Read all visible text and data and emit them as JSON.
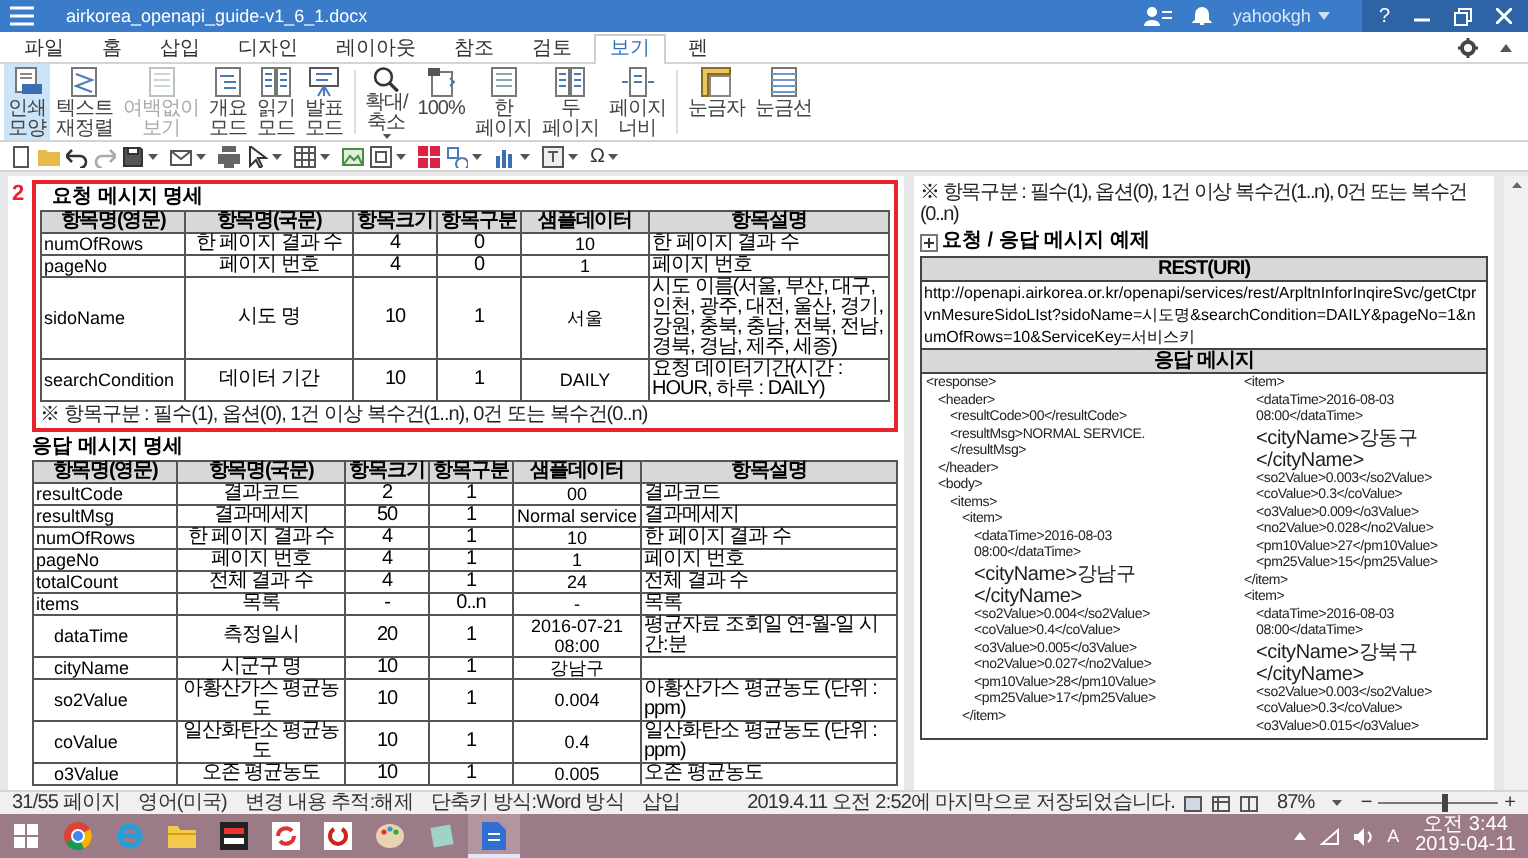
{
  "window": {
    "title": "airkorea_openapi_guide-v1_6_1.docx",
    "user": "yahookgh",
    "help": "?"
  },
  "ribbon_tabs": [
    {
      "label": "파일",
      "selected": false
    },
    {
      "label": "홈",
      "selected": false
    },
    {
      "label": "삽입",
      "selected": false
    },
    {
      "label": "디자인",
      "selected": false
    },
    {
      "label": "레이아웃",
      "selected": false
    },
    {
      "label": "참조",
      "selected": false
    },
    {
      "label": "검토",
      "selected": false
    },
    {
      "label": "보기",
      "selected": true
    },
    {
      "label": "펜",
      "selected": false
    }
  ],
  "ribbon_groups": [
    [
      {
        "label": "인쇄 모양",
        "kind": "print",
        "selected": true,
        "disabled": false
      },
      {
        "label": "텍스트 재정렬",
        "kind": "reflow",
        "selected": false,
        "disabled": false
      },
      {
        "label": "여백없이 보기",
        "kind": "page",
        "selected": false,
        "disabled": true
      },
      {
        "label": "개요 모드",
        "kind": "outline",
        "selected": false,
        "disabled": false
      },
      {
        "label": "읽기 모드",
        "kind": "book",
        "selected": false,
        "disabled": false
      },
      {
        "label": "발표 모드",
        "kind": "easel",
        "selected": false,
        "disabled": false
      }
    ],
    [
      {
        "label": "확대/축소",
        "kind": "zoom",
        "selected": false,
        "disabled": false
      },
      {
        "label": "100%",
        "kind": "actual",
        "selected": false,
        "disabled": false
      },
      {
        "label": "한 페이지",
        "kind": "page",
        "selected": false,
        "disabled": false
      },
      {
        "label": "두 페이지",
        "kind": "book",
        "selected": false,
        "disabled": false
      },
      {
        "label": "페이지 너비",
        "kind": "width",
        "selected": false,
        "disabled": false
      }
    ],
    [
      {
        "label": "눈금자",
        "kind": "ruler",
        "selected": false,
        "disabled": false
      },
      {
        "label": "눈금선",
        "kind": "grid",
        "selected": false,
        "disabled": false
      }
    ]
  ],
  "quick_toolbar": {
    "symbol": "Ω"
  },
  "document": {
    "left_page": {
      "annotation": "2",
      "request": {
        "heading": "요청 메시지 명세",
        "columns": [
          "항목명(영문)",
          "항목명(국문)",
          "항목크기",
          "항목구분",
          "샘플데이터",
          "항목설명"
        ],
        "rows": [
          {
            "cells": [
              "numOfRows",
              "한 페이지 결과 수",
              "4",
              "0",
              "10",
              "한 페이지 결과 수"
            ]
          },
          {
            "cells": [
              "pageNo",
              "페이지 번호",
              "4",
              "0",
              "1",
              "페이지 번호"
            ]
          },
          {
            "cells": [
              "sidoName",
              "시도 명",
              "10",
              "1",
              "서울",
              "시도 이름(서울, 부산, 대구, 인천, 광주, 대전, 울산, 경기, 강원, 충북, 충남, 전북, 전남, 경북, 경남, 제주, 세종)"
            ]
          },
          {
            "cells": [
              "searchCondition",
              "데이터 기간",
              "10",
              "1",
              "DAILY",
              "요청 데이터기간(시간 : HOUR, 하루 : DAILY)"
            ]
          }
        ],
        "note": "※ 항목구분 : 필수(1), 옵션(0), 1건 이상 복수건(1..n), 0건 또는 복수건(0..n)"
      },
      "response": {
        "heading": "응답 메시지 명세",
        "columns": [
          "항목명(영문)",
          "항목명(국문)",
          "항목크기",
          "항목구분",
          "샘플데이터",
          "항목설명"
        ],
        "rows": [
          {
            "cells": [
              "resultCode",
              "결과코드",
              "2",
              "1",
              "00",
              "결과코드"
            ]
          },
          {
            "cells": [
              "resultMsg",
              "결과메세지",
              "50",
              "1",
              "Normal service",
              "결과메세지"
            ]
          },
          {
            "cells": [
              "numOfRows",
              "한 페이지 결과 수",
              "4",
              "1",
              "10",
              "한 페이지 결과 수"
            ]
          },
          {
            "cells": [
              "pageNo",
              "페이지 번호",
              "4",
              "1",
              "1",
              "페이지 번호"
            ]
          },
          {
            "cells": [
              "totalCount",
              "전체 결과 수",
              "4",
              "1",
              "24",
              "전체 결과 수"
            ]
          },
          {
            "cells": [
              "items",
              "목록",
              "-",
              "0..n",
              "-",
              "목록"
            ],
            "children": [
              {
                "cells": [
                  "dataTime",
                  "측정일시",
                  "20",
                  "1",
                  "2016-07-21 08:00",
                  "평균자료 조회일 연-월-일 시간:분"
                ]
              },
              {
                "cells": [
                  "cityName",
                  "시군구 명",
                  "10",
                  "1",
                  "강남구"
                ]
              },
              {
                "cells": [
                  "so2Value",
                  "아황산가스 평균농도",
                  "10",
                  "1",
                  "0.004",
                  "아황산가스 평균농도 (단위 : ppm)"
                ]
              },
              {
                "cells": [
                  "coValue",
                  "일산화탄소 평균농도",
                  "10",
                  "1",
                  "0.4",
                  "일산화탄소 평균농도 (단위 : ppm)"
                ]
              },
              {
                "cells": [
                  "o3Value",
                  "오존 평균농도",
                  "10",
                  "1",
                  "0.005",
                  "오존 평균농도"
                ]
              }
            ]
          }
        ]
      }
    },
    "right_page": {
      "note": "※ 항목구분 : 필수(1), 옵션(0), 1건 이상 복수건(1..n), 0건 또는 복수건(0..n)",
      "heading": "요청 / 응답 메시지 예제",
      "uri_header": "REST(URI)",
      "uri": "http://openapi.airkorea.or.kr/openapi/services/rest/ArpltnInforInqireSvc/getCtprvnMesureSidoLIst?sidoName=시도명&searchCondition=DAILY&pageNo=1&numOfRows=10&ServiceKey=서비스키",
      "response_header": "응답 메시지",
      "xml": [
        {
          "text": "<response>",
          "children": [
            {
              "text": "<header>",
              "children": [
                {
                  "text": "<resultCode>00</resultCode>"
                },
                {
                  "text": "<resultMsg>NORMAL SERVICE.</resultMsg>"
                }
              ]
            },
            {
              "text": "</header>"
            },
            {
              "text": "<body>",
              "children": [
                {
                  "text": "<items>",
                  "children": [
                    {
                      "text": "<item>",
                      "children": [
                        {
                          "text": "<dataTime>2016-08-03 08:00</dataTime>"
                        },
                        {
                          "text": "<cityName>강남구</cityName>"
                        },
                        {
                          "text": "<so2Value>0.004</so2Value>"
                        },
                        {
                          "text": "<coValue>0.4</coValue>"
                        },
                        {
                          "text": "<o3Value>0.005</o3Value>"
                        },
                        {
                          "text": "<no2Value>0.027</no2Value>"
                        },
                        {
                          "text": "<pm10Value>28</pm10Value>"
                        },
                        {
                          "text": "<pm25Value>17</pm25Value>"
                        }
                      ]
                    },
                    {
                      "text": "</item>"
                    },
                    {
                      "text": "<item>",
                      "children": [
                        {
                          "text": "<dataTime>2016-08-03 08:00</dataTime>"
                        },
                        {
                          "text": "<cityName>강동구</cityName>"
                        },
                        {
                          "text": "<so2Value>0.003</so2Value>"
                        },
                        {
                          "text": "<coValue>0.3</coValue>"
                        },
                        {
                          "text": "<o3Value>0.009</o3Value>"
                        },
                        {
                          "text": "<no2Value>0.028</no2Value>"
                        },
                        {
                          "text": "<pm10Value>27</pm10Value>"
                        },
                        {
                          "text": "<pm25Value>15</pm25Value>"
                        }
                      ]
                    },
                    {
                      "text": "</item>"
                    },
                    {
                      "text": "<item>",
                      "children": [
                        {
                          "text": "<dataTime>2016-08-03 08:00</dataTime>"
                        },
                        {
                          "text": "<cityName>강북구</cityName>"
                        },
                        {
                          "text": "<so2Value>0.003</so2Value>"
                        },
                        {
                          "text": "<coValue>0.3</coValue>"
                        },
                        {
                          "text": "<o3Value>0.015</o3Value>"
                        }
                      ]
                    }
                  ]
                }
              ]
            }
          ]
        }
      ]
    }
  },
  "status_bar": {
    "items": [
      "31/55 페이지",
      "영어(미국)",
      "변경 내용 추적:해제",
      "단축키 방식:Word 방식",
      "삽입"
    ],
    "save_message": "2019.4.11 오전 2:52에 마지막으로 저장되었습니다.",
    "zoom": "87%",
    "zoom_out": "−",
    "zoom_in": "+",
    "zoom_slider": {
      "level": 0.55
    }
  },
  "taskbar": {
    "apps": [
      {
        "kind": "start",
        "selected": false
      },
      {
        "kind": "browser",
        "selected": false
      },
      {
        "kind": "ring",
        "selected": false
      },
      {
        "kind": "folder",
        "selected": false
      },
      {
        "kind": "switch",
        "selected": false
      },
      {
        "kind": "sync",
        "selected": false
      },
      {
        "kind": "power",
        "selected": false
      },
      {
        "kind": "palette",
        "selected": false
      },
      {
        "kind": "notes",
        "selected": false
      },
      {
        "kind": "document",
        "selected": true
      }
    ],
    "ime": "A",
    "time": "오전 3:44",
    "date": "2019-04-11"
  }
}
